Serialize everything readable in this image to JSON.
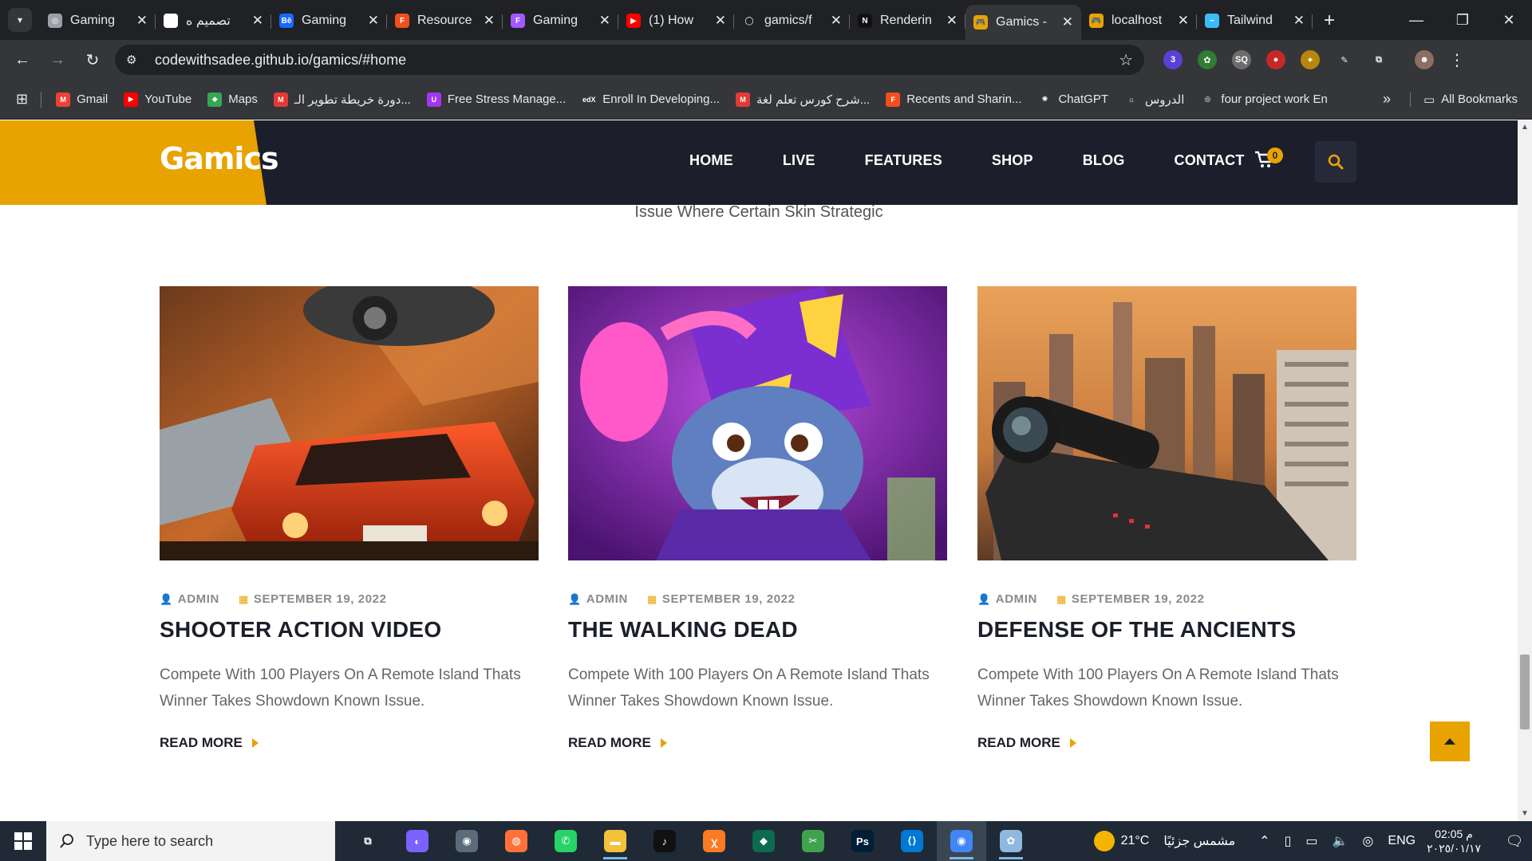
{
  "browser": {
    "tabs": [
      {
        "title": "Gaming",
        "icon": "globe-icon",
        "color": "#9aa0a6",
        "glyph": "◎",
        "active": false
      },
      {
        "title": "تصميم ه",
        "icon": "chatgpt-icon",
        "color": "#ffffff",
        "glyph": "✺",
        "active": false
      },
      {
        "title": "Gaming",
        "icon": "behance-icon",
        "color": "#1769ff",
        "glyph": "Bē",
        "active": false
      },
      {
        "title": "Resource",
        "icon": "figma-icon",
        "color": "#f24e1e",
        "glyph": "F",
        "active": false
      },
      {
        "title": "Gaming",
        "icon": "figma-icon",
        "color": "#a259ff",
        "glyph": "F",
        "active": false
      },
      {
        "title": "(1) How",
        "icon": "youtube-icon",
        "color": "#ff0000",
        "glyph": "▶",
        "active": false
      },
      {
        "title": "gamics/f",
        "icon": "github-icon",
        "color": "#202124",
        "glyph": "◯",
        "active": false
      },
      {
        "title": "Renderin",
        "icon": "notion-icon",
        "color": "#111111",
        "glyph": "N",
        "active": false
      },
      {
        "title": "Gamics -",
        "icon": "gamepad-icon",
        "color": "#e8a300",
        "glyph": "🎮",
        "active": true
      },
      {
        "title": "localhost",
        "icon": "gamepad-icon",
        "color": "#e8a300",
        "glyph": "🎮",
        "active": false
      },
      {
        "title": "Tailwind",
        "icon": "tailwind-icon",
        "color": "#38bdf8",
        "glyph": "~",
        "active": false
      }
    ],
    "url": "codewithsadee.github.io/gamics/#home",
    "bookmarks": [
      {
        "label": "Gmail",
        "icon": "gmail-icon",
        "color": "#ea4335",
        "glyph": "M"
      },
      {
        "label": "YouTube",
        "icon": "youtube-icon",
        "color": "#ff0000",
        "glyph": "▶"
      },
      {
        "label": "Maps",
        "icon": "maps-icon",
        "color": "#34a853",
        "glyph": "◆"
      },
      {
        "label": "دورة خريطة تطوير الـ...",
        "icon": "m-icon",
        "color": "#e53935",
        "glyph": "M"
      },
      {
        "label": "Free Stress Manage...",
        "icon": "udemy-icon",
        "color": "#a435f0",
        "glyph": "U"
      },
      {
        "label": "Enroll In Developing...",
        "icon": "edx-icon",
        "color": "#35363a",
        "glyph": "edX"
      },
      {
        "label": "شرح كورس تعلم لغة...",
        "icon": "m-icon",
        "color": "#e53935",
        "glyph": "M"
      },
      {
        "label": "Recents and Sharin...",
        "icon": "figma-icon",
        "color": "#f24e1e",
        "glyph": "F"
      },
      {
        "label": "ChatGPT",
        "icon": "chatgpt-icon",
        "color": "#35363a",
        "glyph": "✺"
      },
      {
        "label": "الدروس",
        "icon": "school-icon",
        "color": "#35363a",
        "glyph": "⌂"
      },
      {
        "label": "four project work En",
        "icon": "globe-icon",
        "color": "#35363a",
        "glyph": "◎"
      }
    ],
    "all_bookmarks": "All Bookmarks"
  },
  "site": {
    "logo": "Gamics",
    "nav": [
      "HOME",
      "LIVE",
      "FEATURES",
      "SHOP",
      "BLOG",
      "CONTACT"
    ],
    "cart_count": "0",
    "subtitle": "Issue Where Certain Skin Strategic",
    "cards": [
      {
        "author": "ADMIN",
        "date": "SEPTEMBER 19, 2022",
        "title": "SHOOTER ACTION VIDEO",
        "text": "Compete With 100 Players On A Remote Island Thats Winner Takes Showdown Known Issue.",
        "read_more": "READ MORE",
        "image": "car-chase-image"
      },
      {
        "author": "ADMIN",
        "date": "SEPTEMBER 19, 2022",
        "title": "THE WALKING DEAD",
        "text": "Compete With 100 Players On A Remote Island Thats Winner Takes Showdown Known Issue.",
        "read_more": "READ MORE",
        "image": "wizard-mouse-image"
      },
      {
        "author": "ADMIN",
        "date": "SEPTEMBER 19, 2022",
        "title": "DEFENSE OF THE ANCIENTS",
        "text": "Compete With 100 Players On A Remote Island Thats Winner Takes Showdown Known Issue.",
        "read_more": "READ MORE",
        "image": "sniper-city-image"
      }
    ],
    "colors": {
      "accent": "#e8a300",
      "dark": "#1c1f2b"
    }
  },
  "taskbar": {
    "search_placeholder": "Type here to search",
    "temperature": "21°C",
    "weather_text": "مشمس جزئيًا",
    "language": "ENG",
    "time": "02:05 م",
    "date": "٢٠٢٥/٠١/١٧",
    "apps": [
      {
        "icon": "task-view-icon",
        "color": "#1f2a36",
        "glyph": "⧉",
        "open": false
      },
      {
        "icon": "copilot-icon",
        "color": "#7b61ff",
        "glyph": "◐",
        "open": false
      },
      {
        "icon": "camera-icon",
        "color": "#5b6b7b",
        "glyph": "◉",
        "open": false
      },
      {
        "icon": "firefox-icon",
        "color": "#ff7139",
        "glyph": "◍",
        "open": false
      },
      {
        "icon": "whatsapp-icon",
        "color": "#25d366",
        "glyph": "✆",
        "open": false
      },
      {
        "icon": "file-explorer-icon",
        "color": "#f3c13a",
        "glyph": "▬",
        "open": true
      },
      {
        "icon": "tiktok-icon",
        "color": "#111111",
        "glyph": "♪",
        "open": false
      },
      {
        "icon": "xampp-icon",
        "color": "#fb7a24",
        "glyph": "ꭓ",
        "open": false
      },
      {
        "icon": "dark-app-icon",
        "color": "#0a6b4f",
        "glyph": "◆",
        "open": false
      },
      {
        "icon": "snip-tool-icon",
        "color": "#3fa34d",
        "glyph": "✂",
        "open": false
      },
      {
        "icon": "photoshop-icon",
        "color": "#001e36",
        "glyph": "Ps",
        "open": false
      },
      {
        "icon": "vscode-icon",
        "color": "#0078d4",
        "glyph": "⟨⟩",
        "open": false
      },
      {
        "icon": "chrome-icon",
        "color": "#4285f4",
        "glyph": "◉",
        "open": true,
        "active": true
      },
      {
        "icon": "paint-icon",
        "color": "#8fb8de",
        "glyph": "✿",
        "open": true
      }
    ]
  }
}
